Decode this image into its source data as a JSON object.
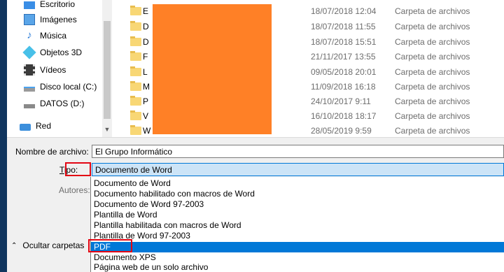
{
  "nav": {
    "items": [
      {
        "label": "Escritorio",
        "icon": "desktop-icon"
      },
      {
        "label": "Imágenes",
        "icon": "pictures-icon"
      },
      {
        "label": "Música",
        "icon": "music-icon"
      },
      {
        "label": "Objetos 3D",
        "icon": "objects-3d-icon"
      },
      {
        "label": "Vídeos",
        "icon": "videos-icon"
      },
      {
        "label": "Disco local (C:)",
        "icon": "local-disk-icon"
      },
      {
        "label": "DATOS (D:)",
        "icon": "drive-icon"
      },
      {
        "label": "Red",
        "icon": "network-icon"
      }
    ]
  },
  "files": [
    {
      "name": "E",
      "date": "18/07/2018 12:04",
      "type": "Carpeta de archivos"
    },
    {
      "name": "D",
      "date": "18/07/2018 11:55",
      "type": "Carpeta de archivos"
    },
    {
      "name": "D",
      "date": "18/07/2018 15:51",
      "type": "Carpeta de archivos"
    },
    {
      "name": "F",
      "date": "21/11/2017 13:55",
      "type": "Carpeta de archivos"
    },
    {
      "name": "L",
      "date": "09/05/2018 20:01",
      "type": "Carpeta de archivos"
    },
    {
      "name": "M",
      "date": "11/09/2018 16:18",
      "type": "Carpeta de archivos"
    },
    {
      "name": "P",
      "date": "24/10/2017 9:11",
      "type": "Carpeta de archivos"
    },
    {
      "name": "V",
      "date": "16/10/2018 18:17",
      "type": "Carpeta de archivos"
    },
    {
      "name": "W",
      "date": "28/05/2019 9:59",
      "type": "Carpeta de archivos"
    }
  ],
  "form": {
    "filename_label": "Nombre de archivo:",
    "filename_value": "El Grupo Informático",
    "tipo_label_underlined": "T",
    "tipo_label_rest": "ipo:",
    "tipo_value": "Documento de Word",
    "authors_label": "Autores:"
  },
  "type_options": [
    "Documento de Word",
    "Documento habilitado con macros de Word",
    "Documento de Word 97-2003",
    "Plantilla de Word",
    "Plantilla habilitada con macros de Word",
    "Plantilla de Word 97-2003",
    "PDF",
    "Documento XPS",
    "Página web de un solo archivo"
  ],
  "selected_option_index": 6,
  "hide_folders_label": "Ocultar carpetas",
  "colors": {
    "highlight": "#0078d7",
    "annotation_red": "#e30613",
    "redaction": "#ff8026",
    "folder": "#f8d775"
  }
}
